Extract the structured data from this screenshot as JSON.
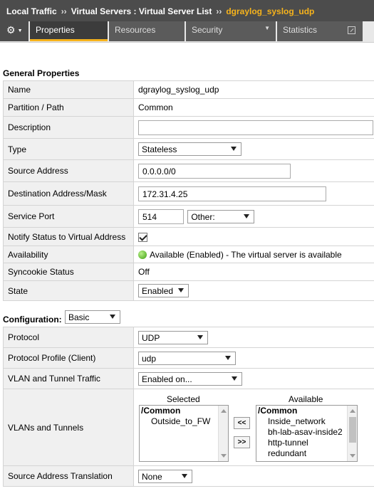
{
  "breadcrumb": {
    "items": [
      "Local Traffic",
      "Virtual Servers : Virtual Server List"
    ],
    "separator": "››",
    "current": "dgraylog_syslog_udp"
  },
  "tabs": {
    "gear_icon": "gear-icon",
    "properties": "Properties",
    "resources": "Resources",
    "security": "Security",
    "statistics": "Statistics"
  },
  "general": {
    "title": "General Properties",
    "name_label": "Name",
    "name_value": "dgraylog_syslog_udp",
    "partition_label": "Partition / Path",
    "partition_value": "Common",
    "description_label": "Description",
    "description_value": "",
    "type_label": "Type",
    "type_value": "Stateless",
    "source_label": "Source Address",
    "source_value": "0.0.0.0/0",
    "destination_label": "Destination Address/Mask",
    "destination_value": "172.31.4.25",
    "port_label": "Service Port",
    "port_value": "514",
    "port_select": "Other:",
    "notify_label": "Notify Status to Virtual Address",
    "notify_checked": true,
    "availability_label": "Availability",
    "availability_value": "Available (Enabled) - The virtual server is available",
    "availability_color": "#3e9f10",
    "syncookie_label": "Syncookie Status",
    "syncookie_value": "Off",
    "state_label": "State",
    "state_value": "Enabled"
  },
  "configuration": {
    "title": "Configuration:",
    "mode": "Basic",
    "protocol_label": "Protocol",
    "protocol_value": "UDP",
    "profile_label": "Protocol Profile (Client)",
    "profile_value": "udp",
    "vlan_traffic_label": "VLAN and Tunnel Traffic",
    "vlan_traffic_value": "Enabled on...",
    "vlans_label": "VLANs and Tunnels",
    "selected_heading": "Selected",
    "available_heading": "Available",
    "selected_group": "/Common",
    "selected_items": [
      "Outside_to_FW"
    ],
    "available_group": "/Common",
    "available_items": [
      "Inside_network",
      "bh-lab-asav-inside2",
      "http-tunnel",
      "redundant"
    ],
    "move_left": "<<",
    "move_right": ">>",
    "snat_label": "Source Address Translation",
    "snat_value": "None"
  },
  "colors": {
    "header_bg": "#4c4c4c",
    "accent": "#f6b31c",
    "label_bg": "#f0f0f0"
  }
}
